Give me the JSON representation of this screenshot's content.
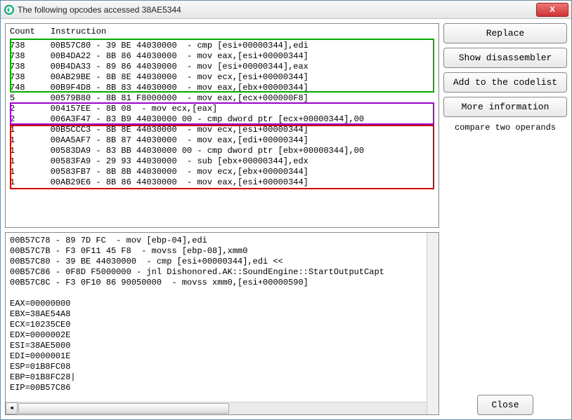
{
  "window": {
    "title": "The following opcodes accessed 38AE5344"
  },
  "headers": {
    "count": "Count",
    "instruction": "Instruction"
  },
  "rows": [
    {
      "count": "738",
      "instr": "00B57C80 - 39 BE 44030000  - cmp [esi+00000344],edi"
    },
    {
      "count": "738",
      "instr": "00B4DA22 - 8B 86 44030000  - mov eax,[esi+00000344]"
    },
    {
      "count": "738",
      "instr": "00B4DA33 - 89 86 44030000  - mov [esi+00000344],eax"
    },
    {
      "count": "738",
      "instr": "00AB29BE - 8B 8E 44030000  - mov ecx,[esi+00000344]"
    },
    {
      "count": "748",
      "instr": "00B9F4D8 - 8B 83 44030000  - mov eax,[ebx+00000344]"
    },
    {
      "count": "5",
      "instr": "00579B80 - 8B 81 F8000000  - mov eax,[ecx+000000F8]"
    },
    {
      "count": "2",
      "instr": "004157EE - 8B 08  - mov ecx,[eax]"
    },
    {
      "count": "2",
      "instr": "006A3F47 - 83 B9 44030000 00 - cmp dword ptr [ecx+00000344],00"
    },
    {
      "count": "1",
      "instr": "00B5CCC3 - 8B 8E 44030000  - mov ecx,[esi+00000344]"
    },
    {
      "count": "1",
      "instr": "00AA5AF7 - 8B 87 44030000  - mov eax,[edi+00000344]"
    },
    {
      "count": "1",
      "instr": "00583DA9 - 83 BB 44030000 00 - cmp dword ptr [ebx+00000344],00"
    },
    {
      "count": "1",
      "instr": "00583FA9 - 29 93 44030000  - sub [ebx+00000344],edx"
    },
    {
      "count": "1",
      "instr": "00583FB7 - 8B 8B 44030000  - mov ecx,[ebx+00000344]"
    },
    {
      "count": "1",
      "instr": "00AB29E6 - 8B 86 44030000  - mov eax,[esi+00000344]"
    }
  ],
  "disasm": "00B57C78 - 89 7D FC  - mov [ebp-04],edi\n00B57C7B - F3 0F11 45 F8  - movss [ebp-08],xmm0\n00B57C80 - 39 BE 44030000  - cmp [esi+00000344],edi <<\n00B57C86 - 0F8D F5000000 - jnl Dishonored.AK::SoundEngine::StartOutputCapt\n00B57C8C - F3 0F10 86 90050000  - movss xmm0,[esi+00000590]\n\nEAX=00000000\nEBX=38AE54A8\nECX=10235CE0\nEDX=0000002E\nESI=38AE5000\nEDI=0000001E\nESP=01B8FC08\nEBP=01B8FC28|\nEIP=00B57C86\n",
  "buttons": {
    "replace": "Replace",
    "show_disasm": "Show disassembler",
    "add_codelist": "Add to the codelist",
    "more_info": "More information",
    "close": "Close"
  },
  "hint": "compare two operands",
  "close_x": "X"
}
